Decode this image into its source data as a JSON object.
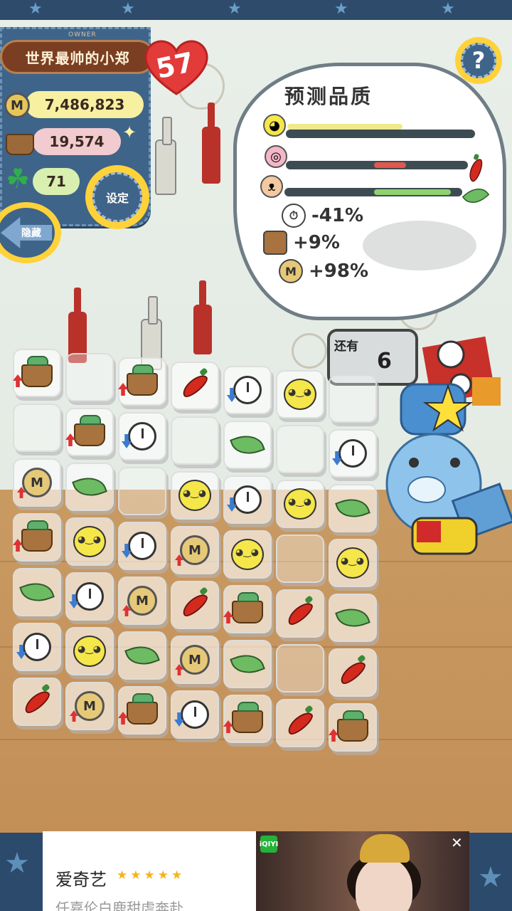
{
  "owner": {
    "caption": "OWNER",
    "name": "世界最帅的小郑",
    "level": "57"
  },
  "resources": {
    "coins": "7,486,823",
    "coin_symbol": "M",
    "baskets": "19,574",
    "clovers": "71"
  },
  "buttons": {
    "settings": "设定",
    "hide": "隐藏",
    "help": "?"
  },
  "quality": {
    "title": "预测品质",
    "bars": [
      {
        "icon": "smile-icon",
        "fill": 0.62,
        "color": "#f1ea8a"
      },
      {
        "icon": "lollipop-icon",
        "fill": 0.18,
        "color": "#e0584e",
        "end_icon": "chili-icon"
      },
      {
        "icon": "pig-icon",
        "fill": 0.44,
        "color": "#8fd16f",
        "end_icon": "leaf-icon"
      }
    ],
    "stats": [
      {
        "icon": "timer-icon",
        "value": "-41%"
      },
      {
        "icon": "basket-icon",
        "value": "+9%"
      },
      {
        "icon": "coin-icon",
        "value": "+98%"
      }
    ]
  },
  "remaining": {
    "label": "还有",
    "value": "6"
  },
  "grid": {
    "rows": [
      [
        "basket",
        "empty",
        "basket",
        "chili",
        "timer",
        "smile",
        "empty"
      ],
      [
        "empty",
        "basket",
        "timer",
        "empty",
        "leaf",
        "empty",
        "timer"
      ],
      [
        "coin",
        "leaf",
        "empty",
        "smile",
        "timer",
        "smile",
        "leaf"
      ],
      [
        "basket",
        "smile",
        "timer",
        "coin",
        "smile",
        "empty",
        "smile"
      ],
      [
        "leaf",
        "timer",
        "coin",
        "chili",
        "basket",
        "chili",
        "leaf"
      ],
      [
        "timer",
        "smile",
        "leaf",
        "coin",
        "leaf",
        "empty",
        "chili"
      ],
      [
        "chili",
        "coin",
        "basket",
        "timer",
        "basket",
        "chili",
        "basket"
      ]
    ]
  },
  "ad": {
    "app_name": "爱奇艺",
    "stars": "★★★★★",
    "subtitle": "任嘉伦白鹿甜虐奔赴",
    "badge": "iQIYI",
    "close": "✕"
  }
}
